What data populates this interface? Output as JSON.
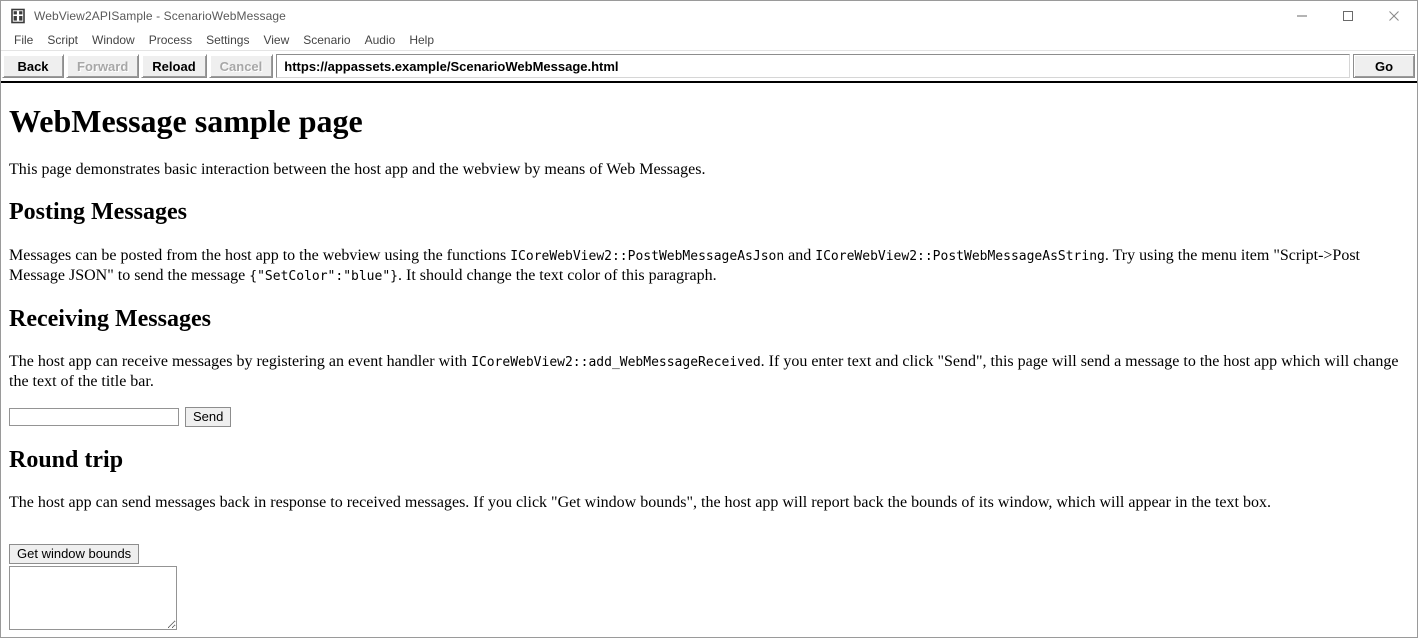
{
  "window": {
    "title": "WebView2APISample - ScenarioWebMessage",
    "icon": "app-grid-icon",
    "controls": {
      "minimize": "minimize-icon",
      "maximize": "maximize-icon",
      "close": "close-icon"
    }
  },
  "menu": {
    "items": [
      {
        "label": "File"
      },
      {
        "label": "Script"
      },
      {
        "label": "Window"
      },
      {
        "label": "Process"
      },
      {
        "label": "Settings"
      },
      {
        "label": "View"
      },
      {
        "label": "Scenario"
      },
      {
        "label": "Audio"
      },
      {
        "label": "Help"
      }
    ]
  },
  "toolbar": {
    "back_label": "Back",
    "forward_label": "Forward",
    "reload_label": "Reload",
    "cancel_label": "Cancel",
    "go_label": "Go",
    "url_value": "https://appassets.example/ScenarioWebMessage.html",
    "url_placeholder": "",
    "back_enabled": true,
    "forward_enabled": false,
    "reload_enabled": true,
    "cancel_enabled": false
  },
  "page": {
    "heading": "WebMessage sample page",
    "intro": "This page demonstrates basic interaction between the host app and the webview by means of Web Messages.",
    "posting": {
      "heading": "Posting Messages",
      "para_part1": "Messages can be posted from the host app to the webview using the functions ",
      "code1": "ICoreWebView2::PostWebMessageAsJson",
      "para_part2": " and ",
      "code2": "ICoreWebView2::PostWebMessageAsString",
      "para_part3": ". Try using the menu item \"Script->Post Message JSON\" to send the message ",
      "code3": "{\"SetColor\":\"blue\"}",
      "para_part4": ". It should change the text color of this paragraph."
    },
    "receiving": {
      "heading": "Receiving Messages",
      "para_part1": "The host app can receive messages by registering an event handler with ",
      "code1": "ICoreWebView2::add_WebMessageReceived",
      "para_part2": ". If you enter text and click \"Send\", this page will send a message to the host app which will change the text of the title bar.",
      "input_value": "",
      "input_placeholder": "",
      "send_label": "Send"
    },
    "roundtrip": {
      "heading": "Round trip",
      "para": "The host app can send messages back in response to received messages. If you click \"Get window bounds\", the host app will report back the bounds of its window, which will appear in the text box.",
      "button_label": "Get window bounds",
      "textarea_value": "",
      "textarea_placeholder": ""
    }
  },
  "colors": {
    "title_text": "#5a5a5a",
    "menu_text": "#444444",
    "disabled_button_text": "#a7a7a7",
    "page_text": "#000000",
    "button_face": "#efefef",
    "border": "#8d8d8d"
  }
}
